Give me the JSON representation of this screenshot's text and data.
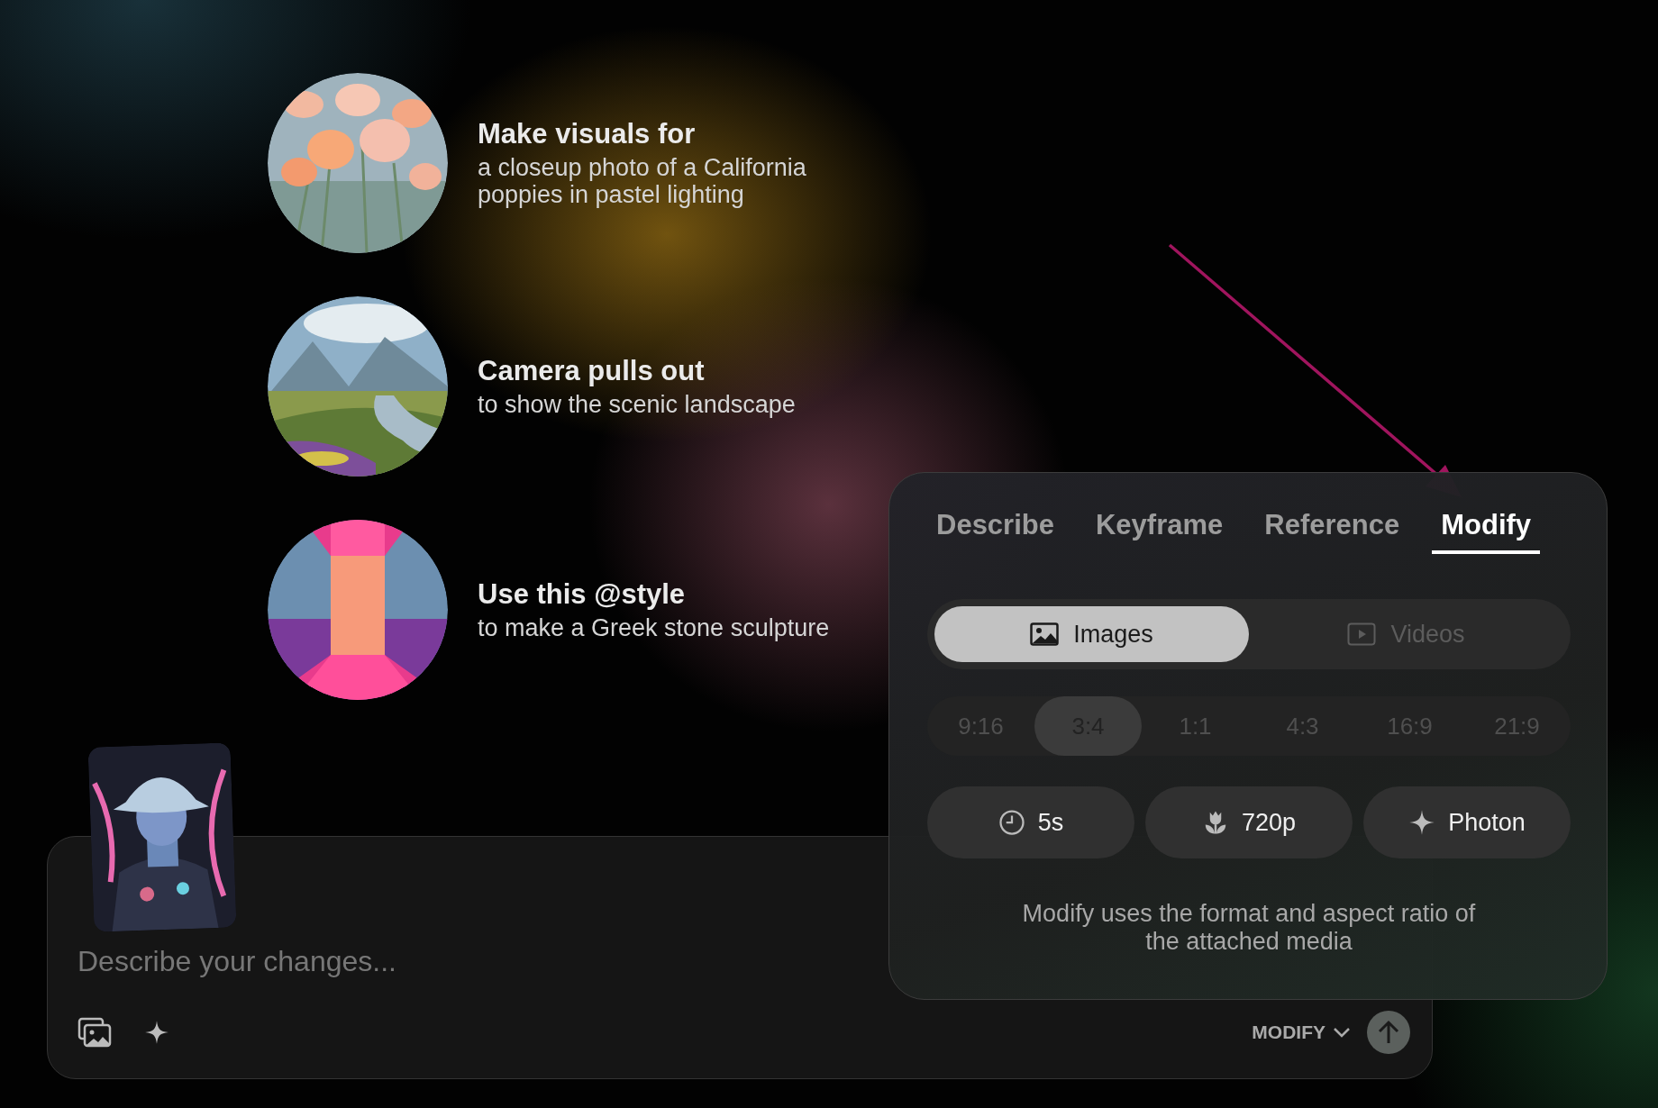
{
  "suggestions": [
    {
      "title": "Make visuals for",
      "subtitle": "a closeup photo of a California poppies in pastel lighting"
    },
    {
      "title": "Camera pulls out",
      "subtitle": "to show the scenic landscape"
    },
    {
      "title": "Use this @style",
      "subtitle": "to make a Greek stone sculpture"
    }
  ],
  "composer": {
    "placeholder": "Describe your changes...",
    "mode": "MODIFY"
  },
  "panel": {
    "tabs": [
      {
        "label": "Describe",
        "selected": false
      },
      {
        "label": "Keyframe",
        "selected": false
      },
      {
        "label": "Reference",
        "selected": false
      },
      {
        "label": "Modify",
        "selected": true
      }
    ],
    "media_types": [
      {
        "label": "Images",
        "kind": "images",
        "selected": true
      },
      {
        "label": "Videos",
        "kind": "videos",
        "selected": false
      }
    ],
    "aspect_ratios_disabled": true,
    "aspect_ratios": [
      {
        "label": "9:16",
        "selected": false
      },
      {
        "label": "3:4",
        "selected": true
      },
      {
        "label": "1:1",
        "selected": false
      },
      {
        "label": "4:3",
        "selected": false
      },
      {
        "label": "16:9",
        "selected": false
      },
      {
        "label": "21:9",
        "selected": false
      }
    ],
    "options": [
      {
        "label": "5s",
        "kind": "duration"
      },
      {
        "label": "720p",
        "kind": "resolution"
      },
      {
        "label": "Photon",
        "kind": "model"
      }
    ],
    "note": "Modify uses the format and aspect ratio of the attached media"
  }
}
